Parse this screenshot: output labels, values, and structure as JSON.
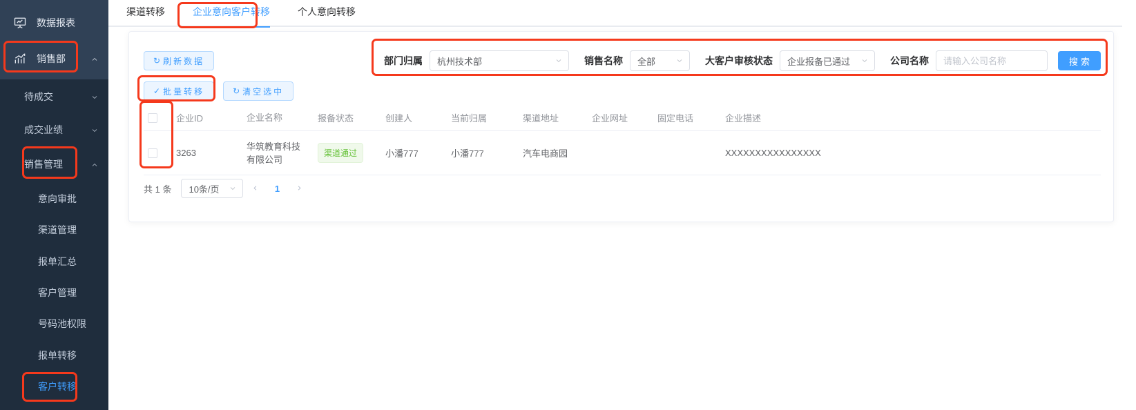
{
  "colors": {
    "accent": "#409eff",
    "annotation_red": "#f5391c",
    "success_green": "#67c23a",
    "sidebar_bg": "#304156",
    "sidebar_submenu_bg": "#1f2d3d"
  },
  "sidebar": {
    "items": [
      {
        "label": "数据报表",
        "icon": "presentation-board-icon"
      },
      {
        "label": "销售部",
        "icon": "bar-chart-icon",
        "chevron": "up"
      },
      {
        "label": "待成交",
        "chevron": "down"
      },
      {
        "label": "成交业绩",
        "chevron": "down"
      },
      {
        "label": "销售管理",
        "chevron": "up"
      },
      {
        "label": "意向审批"
      },
      {
        "label": "渠道管理"
      },
      {
        "label": "报单汇总"
      },
      {
        "label": "客户管理"
      },
      {
        "label": "号码池权限"
      },
      {
        "label": "报单转移"
      },
      {
        "label": "客户转移",
        "active": true
      }
    ]
  },
  "tabs": {
    "channel_transfer": "渠道转移",
    "enterprise_intent_transfer": "企业意向客户转移",
    "personal_intent_transfer": "个人意向转移"
  },
  "toolbar": {
    "refresh_label": "刷新数据",
    "refresh_icon": "↻",
    "batch_transfer_label": "批量转移",
    "batch_transfer_icon": "✓",
    "clear_selected_label": "清空选中",
    "clear_selected_icon": "↻"
  },
  "filters": {
    "department": {
      "label": "部门归属",
      "value": "杭州技术部"
    },
    "sales_name": {
      "label": "销售名称",
      "value": "全部"
    },
    "key_account_review": {
      "label": "大客户审核状态",
      "value": "企业报备已通过"
    },
    "company": {
      "label": "公司名称",
      "placeholder": "请输入公司名称"
    },
    "search_label": "搜索"
  },
  "table": {
    "columns": [
      "企业ID",
      "企业名称",
      "报备状态",
      "创建人",
      "当前归属",
      "渠道地址",
      "企业网址",
      "固定电话",
      "企业描述"
    ],
    "rows": [
      {
        "enterprise_id": "3263",
        "enterprise_name": "华筑教育科技有限公司",
        "report_status": "渠道通过",
        "creator": "小潘777",
        "current_owner": "小潘777",
        "channel_address": "汽车电商园",
        "website": "",
        "phone": "",
        "description": "XXXXXXXXXXXXXXXX"
      }
    ]
  },
  "pagination": {
    "total": "共 1 条",
    "page_size": "10条/页",
    "page": "1"
  }
}
